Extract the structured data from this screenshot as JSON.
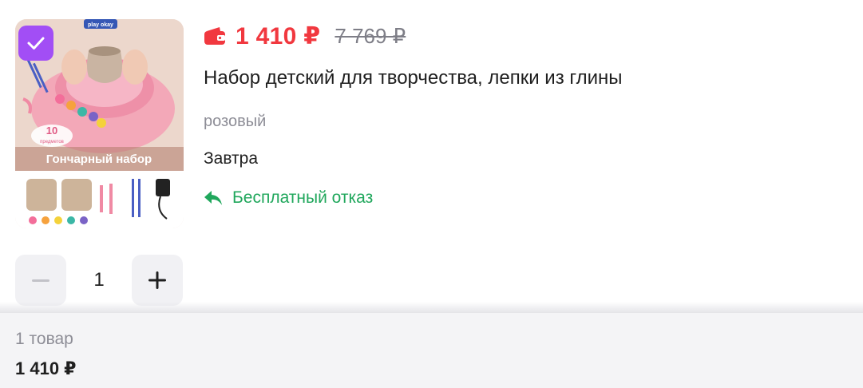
{
  "product": {
    "image_badge": "play okay",
    "image_caption": "Гончарный набор",
    "image_count_num": "10",
    "image_count_word": "предметов",
    "price_current": "1 410 ₽",
    "price_old": "7 769 ₽",
    "title": "Набор детский для творчества, лепки из глины",
    "variant": "розовый",
    "delivery": "Завтра",
    "return_label": "Бесплатный отказ",
    "quantity": "1",
    "selected": true
  },
  "summary": {
    "count_label": "1 товар",
    "total": "1 410 ₽"
  },
  "icons": {
    "checkbox": "check-icon",
    "price": "wallet-icon",
    "return": "return-arrow-icon",
    "decrement": "minus-icon",
    "increment": "plus-icon"
  },
  "colors": {
    "price": "#f1383f",
    "checkbox": "#a24ef5",
    "return": "#20a75c",
    "muted": "#8d8d96"
  }
}
